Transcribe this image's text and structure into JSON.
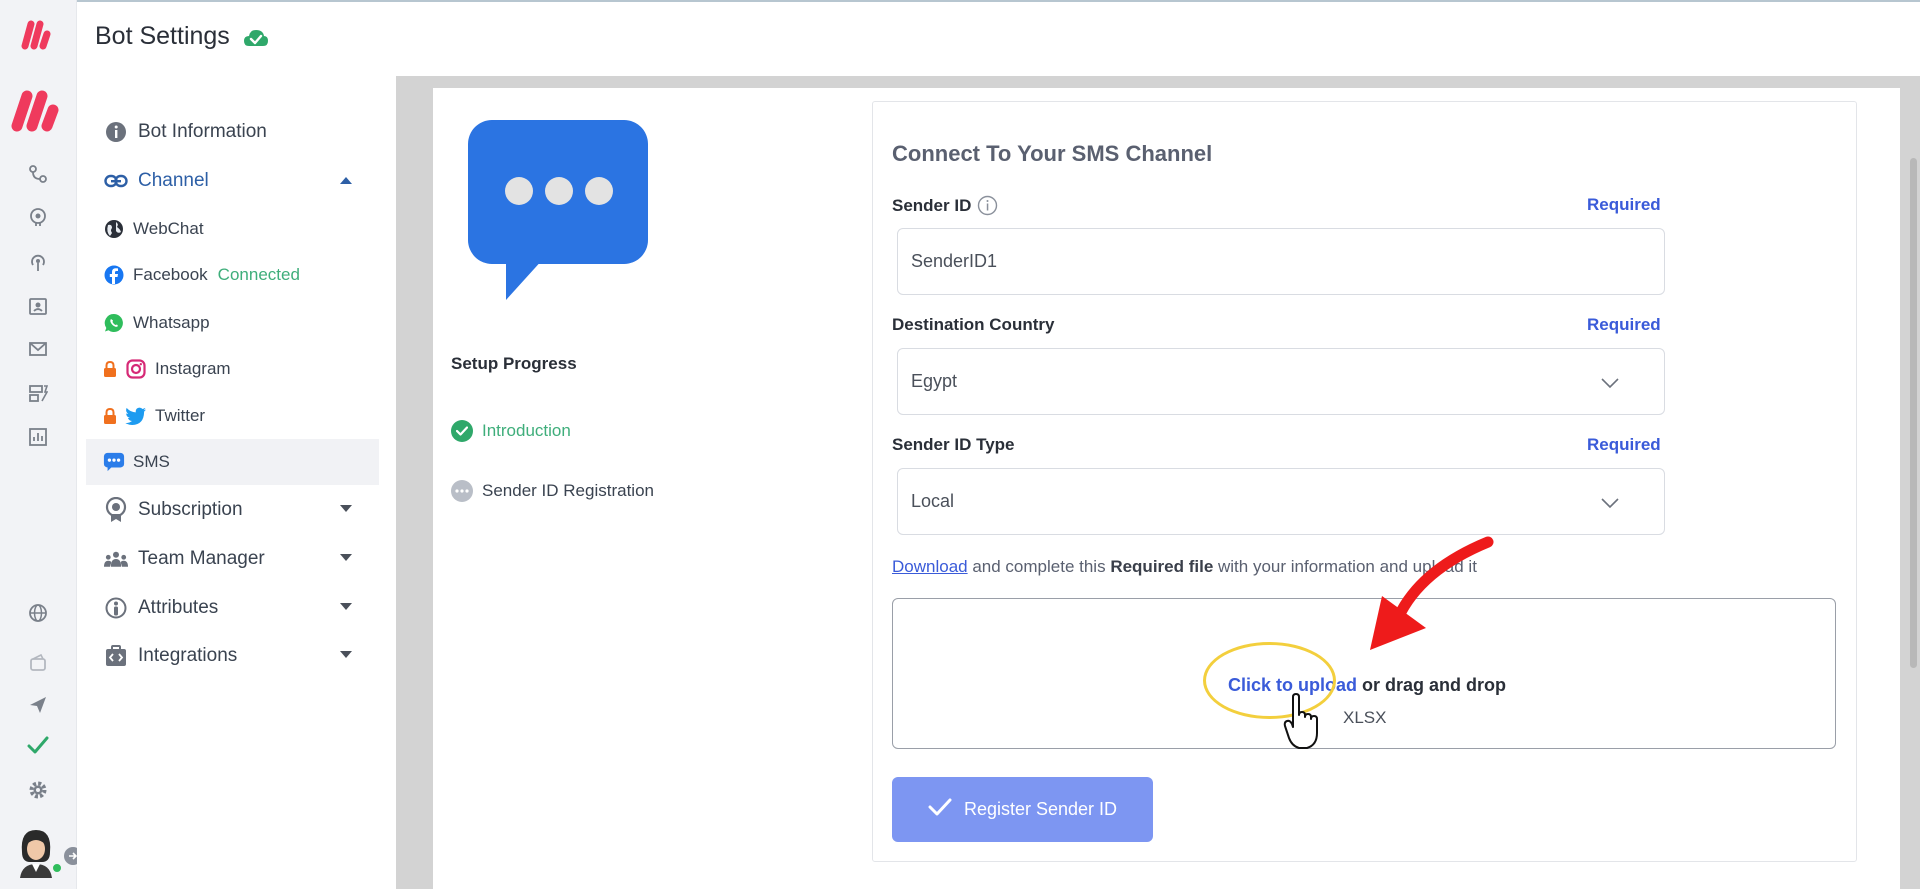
{
  "header": {
    "title": "Bot Settings",
    "status_icon": "cloud-check-icon"
  },
  "rail": {
    "icons": [
      "flow-icon",
      "brain-icon",
      "broadcast-icon",
      "contacts-icon",
      "mail-icon",
      "dashboard-icon",
      "analytics-icon",
      "globe-icon",
      "wallet-icon",
      "send-icon",
      "check-icon",
      "gear-icon"
    ]
  },
  "menu": {
    "bot_information": "Bot Information",
    "channel": "Channel",
    "webchat": "WebChat",
    "facebook": "Facebook",
    "facebook_status": "Connected",
    "whatsapp": "Whatsapp",
    "instagram": "Instagram",
    "twitter": "Twitter",
    "sms": "SMS",
    "subscription": "Subscription",
    "team_manager": "Team Manager",
    "attributes": "Attributes",
    "integrations": "Integrations"
  },
  "setup": {
    "title": "Setup Progress",
    "steps": [
      {
        "label": "Introduction",
        "state": "done"
      },
      {
        "label": "Sender ID Registration",
        "state": "pending"
      }
    ]
  },
  "form": {
    "title": "Connect To Your SMS Channel",
    "sender_id_label": "Sender ID",
    "sender_id_value": "SenderID1",
    "destination_label": "Destination Country",
    "destination_value": "Egypt",
    "sender_type_label": "Sender ID Type",
    "sender_type_value": "Local",
    "required": "Required",
    "download_link": "Download",
    "help_middle": " and complete this ",
    "help_bold": "Required file",
    "help_end": " with your information and upload it",
    "upload_link": "Click to upload",
    "upload_rest": " or drag and drop",
    "upload_hint": "XLSX",
    "register_button": "Register Sender ID"
  },
  "colors": {
    "accent": "#3a5bd9",
    "success": "#3fae7b",
    "brand": "#ef3a5d",
    "button": "#7d96f2"
  }
}
